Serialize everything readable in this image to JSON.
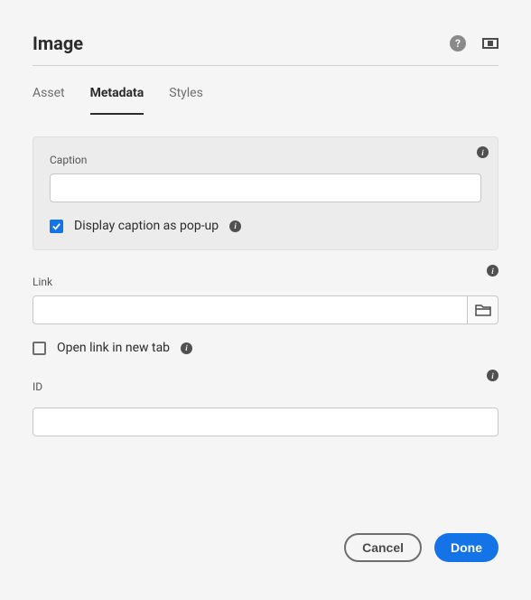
{
  "header": {
    "title": "Image"
  },
  "tabs": {
    "asset": "Asset",
    "metadata": "Metadata",
    "styles": "Styles"
  },
  "caption": {
    "label": "Caption",
    "value": "",
    "popup_label": "Display caption as pop-up",
    "popup_checked": true
  },
  "link": {
    "label": "Link",
    "value": "",
    "newtab_label": "Open link in new tab",
    "newtab_checked": false
  },
  "id": {
    "label": "ID",
    "value": ""
  },
  "footer": {
    "cancel": "Cancel",
    "done": "Done"
  }
}
